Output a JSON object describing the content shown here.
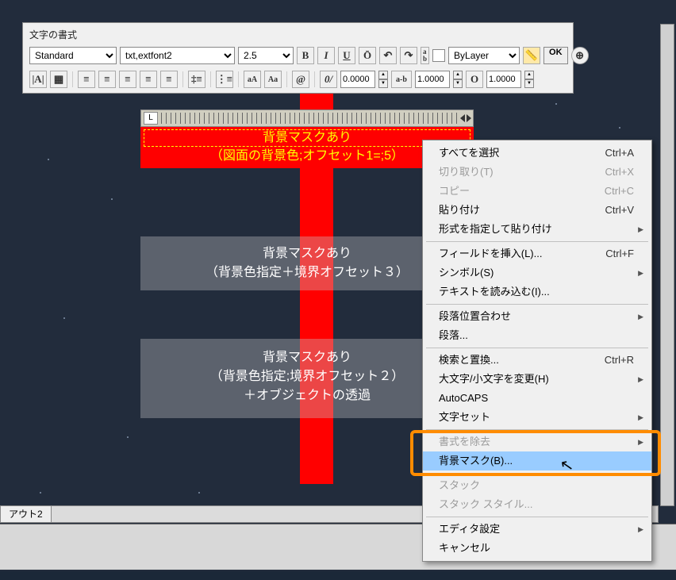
{
  "toolbar": {
    "title": "文字の書式",
    "style_select": "Standard",
    "font_select": "txt,extfont2",
    "height_select": "2.5",
    "bold": "B",
    "italic": "I",
    "underline": "U",
    "overline": "Ō",
    "undo": "↶",
    "redo": "↷",
    "layer_select": "ByLayer",
    "ok": "OK",
    "obliquing": "0/",
    "tracking_value": "0.0000",
    "ab": "a-b",
    "width_value": "1.0000",
    "o_label": "O",
    "o_value": "1.0000",
    "aA": "aA",
    "Aa": "Aa",
    "at": "@"
  },
  "ruler": {
    "L": "L"
  },
  "editText": {
    "line1": "背景マスクあり",
    "line2": "（図面の背景色;オフセット1=;5）"
  },
  "box2": {
    "line1": "背景マスクあり",
    "line2": "（背景色指定＋境界オフセット３）"
  },
  "box3": {
    "line1": "背景マスクあり",
    "line2": "（背景色指定;境界オフセット２）",
    "line3": "＋オブジェクトの透過"
  },
  "tab": {
    "layout2": "アウト2"
  },
  "context": {
    "select_all": "すべてを選択",
    "select_all_sc": "Ctrl+A",
    "cut": "切り取り(T)",
    "cut_sc": "Ctrl+X",
    "copy": "コピー",
    "copy_sc": "Ctrl+C",
    "paste": "貼り付け",
    "paste_sc": "Ctrl+V",
    "paste_special": "形式を指定して貼り付け",
    "insert_field": "フィールドを挿入(L)...",
    "insert_field_sc": "Ctrl+F",
    "symbol": "シンボル(S)",
    "import_text": "テキストを読み込む(I)...",
    "para_align": "段落位置合わせ",
    "paragraph": "段落...",
    "find_replace": "検索と置換...",
    "find_replace_sc": "Ctrl+R",
    "change_case": "大文字/小文字を変更(H)",
    "autocaps": "AutoCAPS",
    "charset": "文字セット",
    "remove_fmt": "書式を除去",
    "bg_mask": "背景マスク(B)...",
    "stack": "スタック",
    "stack_style": "スタック スタイル...",
    "editor_settings": "エディタ設定",
    "cancel": "キャンセル"
  }
}
